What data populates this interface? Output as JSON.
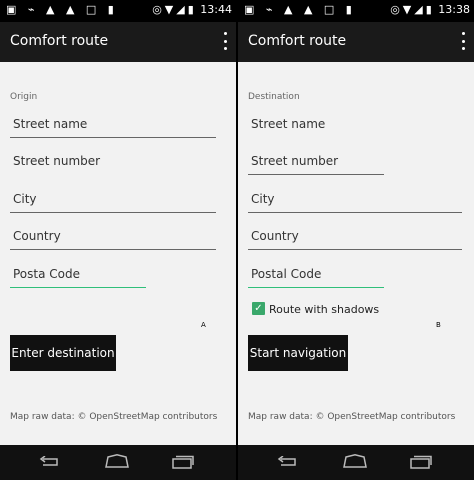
{
  "status_bar": {
    "left_icons": [
      "image-icon",
      "usb-icon",
      "warning-icon",
      "warning-icon",
      "sim-icon",
      "battery-icon"
    ],
    "left_glyphs": "▣ ⌁ ▲ ▲ □ ▮"
  },
  "panels": [
    {
      "status_time": "13:44",
      "app_title": "Comfort route",
      "section_label": "Origin",
      "fields": [
        "Street name",
        "Street number",
        "City",
        "Country",
        "Posta  Code"
      ],
      "button_label": "Enter destination",
      "tag": "A",
      "footer": "Map raw data: © OpenStreetMap contributors"
    },
    {
      "status_time": "13:38",
      "app_title": "Comfort route",
      "section_label": "Destination",
      "fields": [
        "Street name",
        "Street number",
        "City",
        "Country",
        "Postal Code"
      ],
      "checkbox_label": "Route with shadows",
      "checkbox_checked": true,
      "button_label": "Start navigation",
      "tag": "B",
      "footer": "Map raw data: © OpenStreetMap contributors"
    }
  ],
  "colors": {
    "accent": "#2fbf7a",
    "checkbox": "#3aa86b",
    "appbar": "#1a1a1a",
    "background": "#f2f2f2"
  }
}
